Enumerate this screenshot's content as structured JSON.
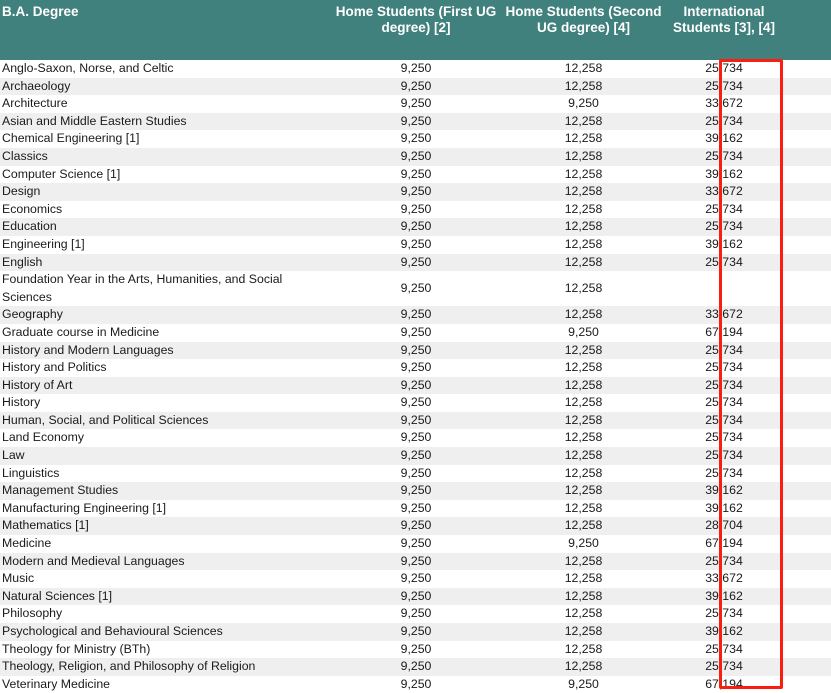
{
  "table": {
    "headers": [
      "B.A. Degree",
      "Home Students (First UG degree) [2]",
      "Home Students (Second UG degree) [4]",
      "International Students [3], [4]",
      ""
    ],
    "rows": [
      {
        "degree": "Anglo-Saxon, Norse, and Celtic",
        "home_first": "9,250",
        "home_second": "12,258",
        "international": "25,734"
      },
      {
        "degree": "Archaeology",
        "home_first": "9,250",
        "home_second": "12,258",
        "international": "25,734"
      },
      {
        "degree": "Architecture",
        "home_first": "9,250",
        "home_second": "9,250",
        "international": "33,672"
      },
      {
        "degree": "Asian and Middle Eastern Studies",
        "home_first": "9,250",
        "home_second": "12,258",
        "international": "25,734"
      },
      {
        "degree": "Chemical Engineering [1]",
        "home_first": "9,250",
        "home_second": "12,258",
        "international": "39,162"
      },
      {
        "degree": "Classics",
        "home_first": "9,250",
        "home_second": "12,258",
        "international": "25,734"
      },
      {
        "degree": "Computer Science [1]",
        "home_first": "9,250",
        "home_second": "12,258",
        "international": "39,162"
      },
      {
        "degree": "Design",
        "home_first": "9,250",
        "home_second": "12,258",
        "international": "33,672"
      },
      {
        "degree": "Economics",
        "home_first": "9,250",
        "home_second": "12,258",
        "international": "25,734"
      },
      {
        "degree": "Education",
        "home_first": "9,250",
        "home_second": "12,258",
        "international": "25,734"
      },
      {
        "degree": "Engineering [1]",
        "home_first": "9,250",
        "home_second": "12,258",
        "international": "39,162"
      },
      {
        "degree": "English",
        "home_first": "9,250",
        "home_second": "12,258",
        "international": "25,734"
      },
      {
        "degree": "Foundation Year in the Arts, Humanities, and Social Sciences",
        "home_first": "9,250",
        "home_second": "12,258",
        "international": ""
      },
      {
        "degree": "Geography",
        "home_first": "9,250",
        "home_second": "12,258",
        "international": "33,672"
      },
      {
        "degree": "Graduate course in Medicine",
        "home_first": "9,250",
        "home_second": "9,250",
        "international": "67,194"
      },
      {
        "degree": "History and Modern Languages",
        "home_first": "9,250",
        "home_second": "12,258",
        "international": "25,734"
      },
      {
        "degree": "History and Politics",
        "home_first": "9,250",
        "home_second": "12,258",
        "international": "25,734"
      },
      {
        "degree": "History of Art",
        "home_first": "9,250",
        "home_second": "12,258",
        "international": "25,734"
      },
      {
        "degree": "History",
        "home_first": "9,250",
        "home_second": "12,258",
        "international": "25,734"
      },
      {
        "degree": "Human, Social, and Political Sciences",
        "home_first": "9,250",
        "home_second": "12,258",
        "international": "25,734"
      },
      {
        "degree": "Land Economy",
        "home_first": "9,250",
        "home_second": "12,258",
        "international": "25,734"
      },
      {
        "degree": "Law",
        "home_first": "9,250",
        "home_second": "12,258",
        "international": "25,734"
      },
      {
        "degree": "Linguistics",
        "home_first": "9,250",
        "home_second": "12,258",
        "international": "25,734"
      },
      {
        "degree": "Management Studies",
        "home_first": "9,250",
        "home_second": "12,258",
        "international": "39,162"
      },
      {
        "degree": "Manufacturing Engineering [1]",
        "home_first": "9,250",
        "home_second": "12,258",
        "international": "39,162"
      },
      {
        "degree": "Mathematics [1]",
        "home_first": "9,250",
        "home_second": "12,258",
        "international": "28,704"
      },
      {
        "degree": "Medicine",
        "home_first": "9,250",
        "home_second": "9,250",
        "international": "67,194"
      },
      {
        "degree": "Modern and Medieval Languages",
        "home_first": "9,250",
        "home_second": "12,258",
        "international": "25,734"
      },
      {
        "degree": "Music",
        "home_first": "9,250",
        "home_second": "12,258",
        "international": "33,672"
      },
      {
        "degree": "Natural Sciences [1]",
        "home_first": "9,250",
        "home_second": "12,258",
        "international": "39,162"
      },
      {
        "degree": "Philosophy",
        "home_first": "9,250",
        "home_second": "12,258",
        "international": "25,734"
      },
      {
        "degree": "Psychological and Behavioural Sciences",
        "home_first": "9,250",
        "home_second": "12,258",
        "international": "39,162"
      },
      {
        "degree": "Theology for Ministry (BTh)",
        "home_first": "9,250",
        "home_second": "12,258",
        "international": "25,734"
      },
      {
        "degree": "Theology, Religion, and Philosophy of Religion",
        "home_first": "9,250",
        "home_second": "12,258",
        "international": "25,734"
      },
      {
        "degree": "Veterinary Medicine",
        "home_first": "9,250",
        "home_second": "9,250",
        "international": "67,194"
      }
    ]
  },
  "annotation": {
    "highlight_color": "#fc1d11",
    "highlighted_column": "International Students [3], [4]"
  },
  "theme": {
    "header_background": "#40807d",
    "header_text": "#ffffff",
    "stripe_background": "#efefef",
    "row_background": "#ffffff",
    "body_text": "#1a1a1a"
  }
}
